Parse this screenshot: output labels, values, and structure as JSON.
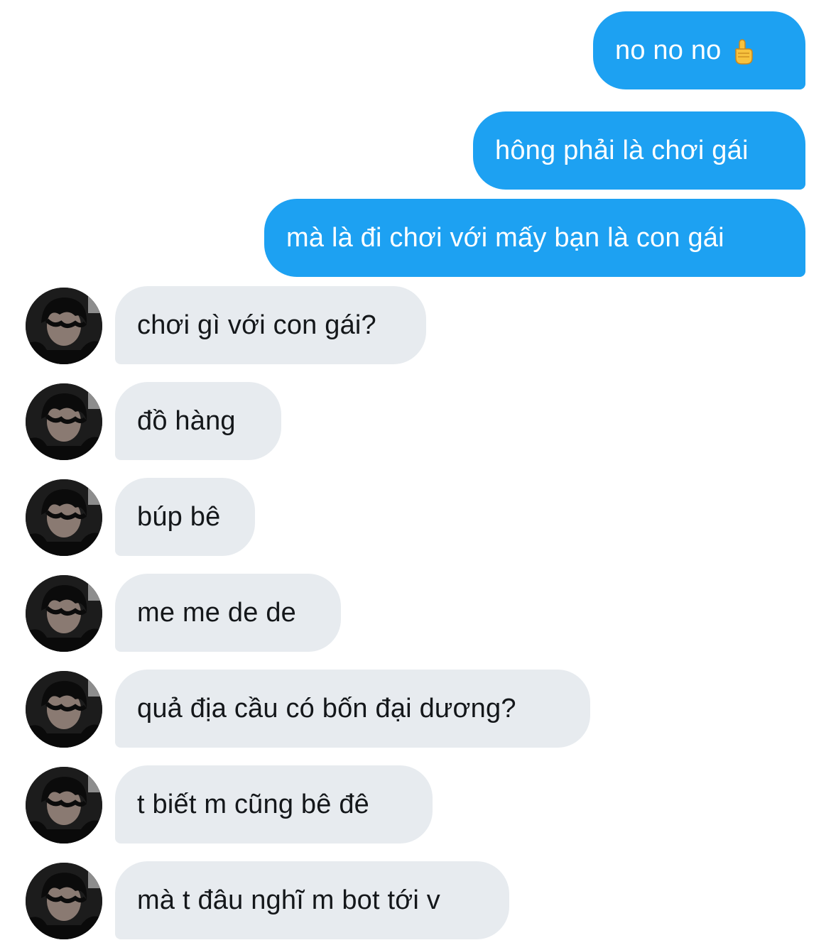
{
  "messages": {
    "sent": [
      {
        "text": "no no no",
        "emoji": "pointing-up-emoji"
      },
      {
        "text": "hông phải là chơi gái"
      },
      {
        "text": "mà là đi chơi với mấy bạn là con gái"
      }
    ],
    "received": [
      {
        "text": "chơi gì với con gái?"
      },
      {
        "text": "đồ hàng"
      },
      {
        "text": "búp bê"
      },
      {
        "text": "me me de de"
      },
      {
        "text": "quả địa cầu có bốn đại dương?"
      },
      {
        "text": "t biết m cũng bê đê"
      },
      {
        "text": "mà t đâu nghĩ m bot tới v"
      }
    ]
  },
  "colors": {
    "sent_bubble": "#1da1f2",
    "received_bubble": "#e7ebef",
    "sent_text": "#ffffff",
    "received_text": "#14171a"
  }
}
